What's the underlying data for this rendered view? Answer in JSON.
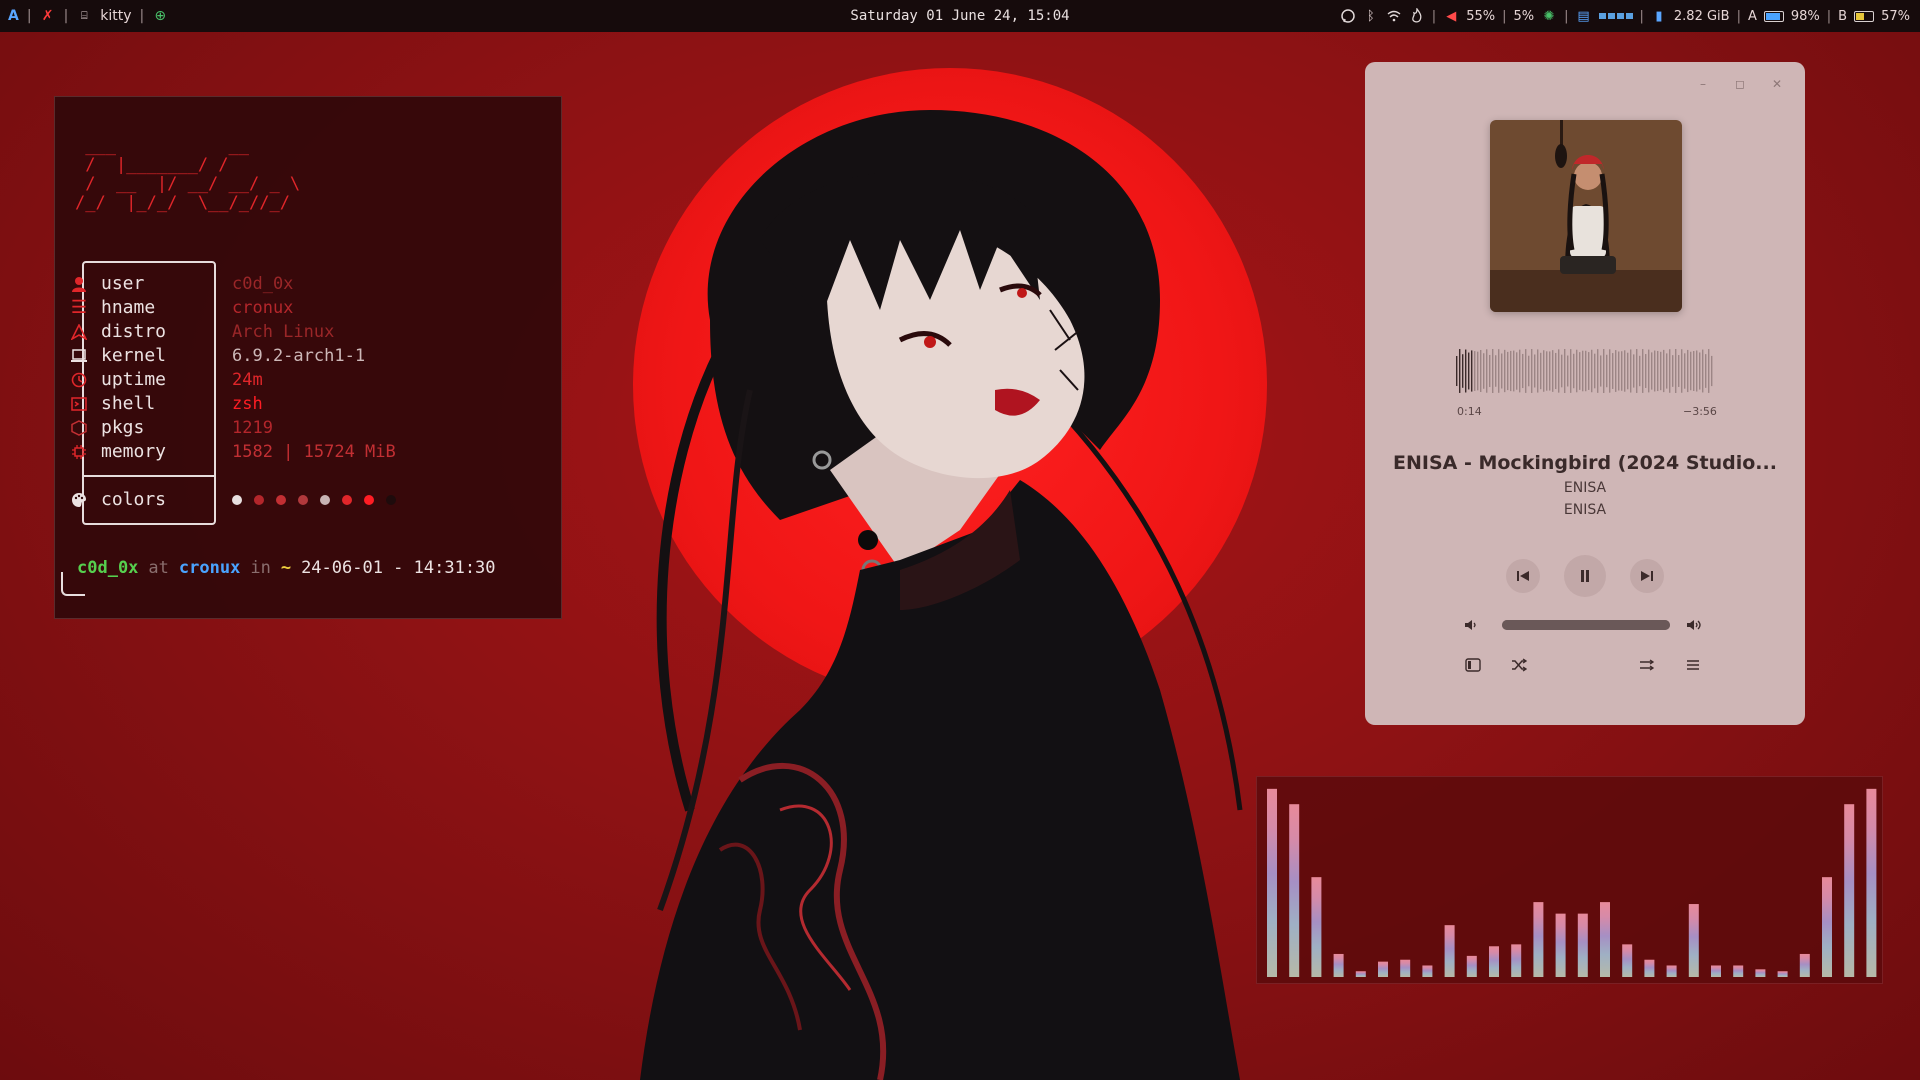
{
  "topbar": {
    "workspace": "A",
    "app_name": "kitty",
    "datetime": "Saturday 01 June 24, 15:04",
    "volume": "55%",
    "brightness": "5%",
    "memory": "2.82 GiB",
    "battery_a_label": "A",
    "battery_a": "98%",
    "battery_b_label": "B",
    "battery_b": "57%"
  },
  "terminal": {
    "ascii_logo": " ___           __\n /  |_______/ /\n /  __  |/ __/ __/ _ \\\n/_/  |_/_/  \\__/_//_/",
    "rows": [
      {
        "label": "user",
        "value": "c0d_0x",
        "icon": "user-icon"
      },
      {
        "label": "hname",
        "value": "cronux",
        "icon": "host-icon"
      },
      {
        "label": "distro",
        "value": "Arch Linux",
        "icon": "arch-icon"
      },
      {
        "label": "kernel",
        "value": "6.9.2-arch1-1",
        "icon": "laptop-icon"
      },
      {
        "label": "uptime",
        "value": "24m",
        "icon": "clock-icon"
      },
      {
        "label": "shell",
        "value": "zsh",
        "icon": "terminal-icon"
      },
      {
        "label": "pkgs",
        "value": "1219",
        "icon": "package-icon"
      },
      {
        "label": "memory",
        "value": "1582 | 15724 MiB",
        "icon": "chip-icon"
      }
    ],
    "colors_label": "colors",
    "palette": [
      "#e8e0e0",
      "#b3262b",
      "#c22f33",
      "#b0393c",
      "#c8b4b4",
      "#e0262a",
      "#ff1d24",
      "#1e0b0c"
    ],
    "prompt": {
      "user": "c0d_0x",
      "at": "at",
      "host": "cronux",
      "in": "in",
      "dir": "~",
      "datetime": "24-06-01 - 14:31:30"
    }
  },
  "player": {
    "time_current": "0:14",
    "time_remaining": "−3:56",
    "title": "ENISA - Mockingbird (2024 Studio...",
    "artist": "ENISA",
    "album": "ENISA",
    "progress": 0.06,
    "volume": 1.0
  },
  "visualizer": {
    "levels": [
      0.98,
      0.9,
      0.52,
      0.12,
      0.03,
      0.08,
      0.09,
      0.06,
      0.27,
      0.11,
      0.16,
      0.17,
      0.39,
      0.33,
      0.33,
      0.39,
      0.17,
      0.09,
      0.06,
      0.38,
      0.06,
      0.06,
      0.04,
      0.03,
      0.12,
      0.52,
      0.9,
      0.98
    ]
  }
}
